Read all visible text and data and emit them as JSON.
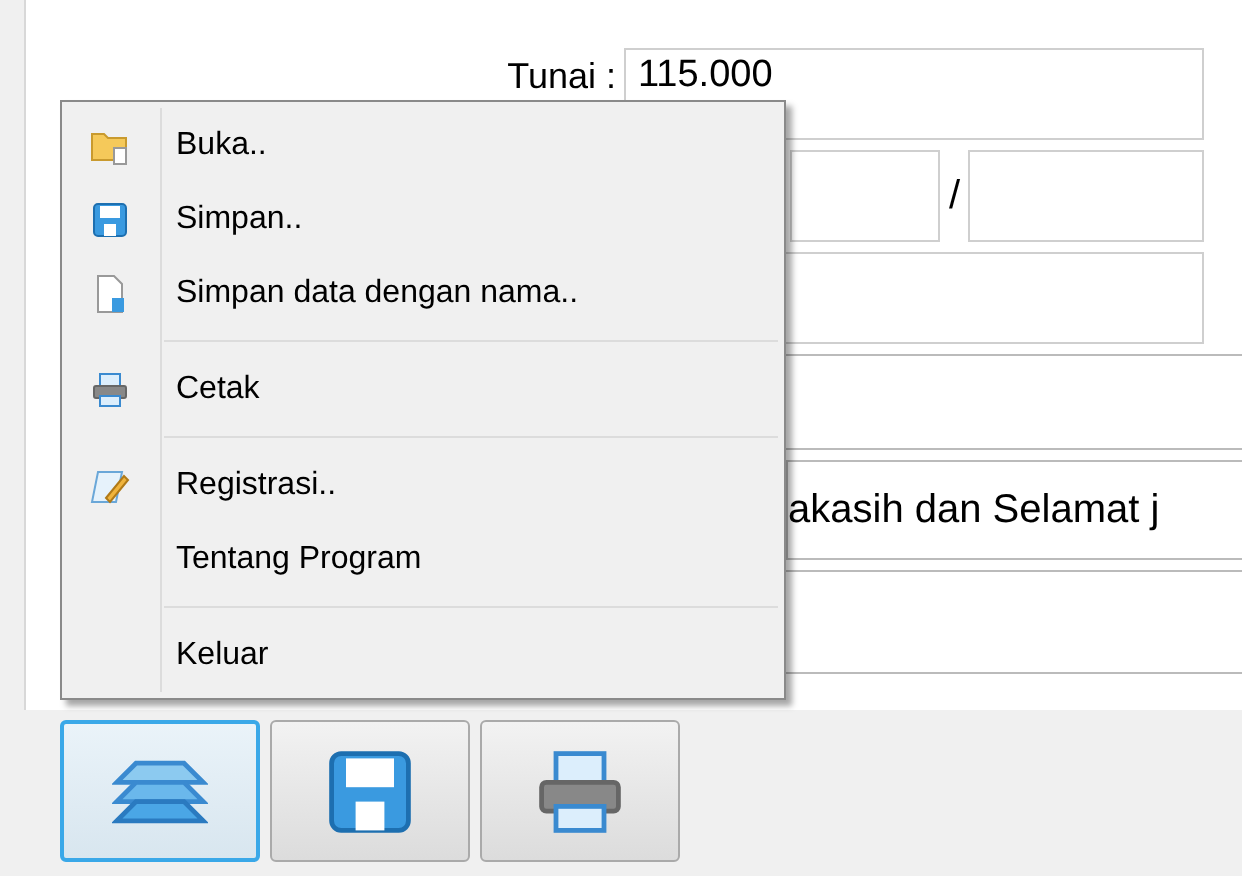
{
  "form": {
    "cash_label": "Tunai :",
    "cash_value": "115.000",
    "date_separator": "/",
    "message_value": "akasih dan Selamat j"
  },
  "menu": {
    "items": [
      {
        "kind": "open",
        "label": "Buka.."
      },
      {
        "kind": "save",
        "label": "Simpan.."
      },
      {
        "kind": "save-as",
        "label": "Simpan data dengan nama.."
      },
      {
        "kind": "separator"
      },
      {
        "kind": "print",
        "label": "Cetak"
      },
      {
        "kind": "separator"
      },
      {
        "kind": "register",
        "label": "Registrasi.."
      },
      {
        "kind": "plain",
        "label": "Tentang Program"
      },
      {
        "kind": "separator"
      },
      {
        "kind": "plain",
        "label": "Keluar"
      }
    ]
  },
  "toolbar": [
    {
      "kind": "layers",
      "selected": true
    },
    {
      "kind": "save",
      "selected": false
    },
    {
      "kind": "print",
      "selected": false
    }
  ]
}
